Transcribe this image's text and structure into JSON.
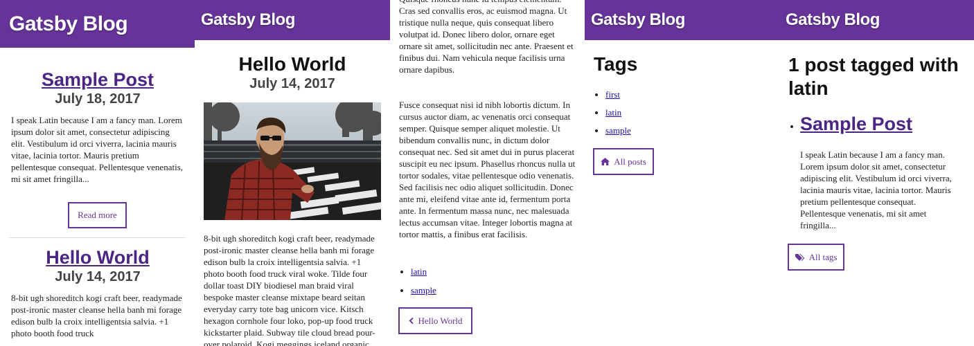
{
  "site_title": "Gatsby Blog",
  "brand_color": "#663399",
  "home": {
    "posts": [
      {
        "title": "Sample Post",
        "date": "July 18, 2017",
        "excerpt": "I speak Latin because I am a fancy man. Lorem ipsum dolor sit amet, consectetur adipiscing elit. Vestibulum id orci viverra, lacinia mauris vitae, lacinia tortor. Mauris pretium pellentesque consequat. Pellentesque venenatis, mi sit amet fringilla...",
        "read_more": "Read more"
      },
      {
        "title": "Hello World",
        "date": "July 14, 2017",
        "excerpt": "8-bit ugh shoreditch kogi craft beer, readymade post-ironic master cleanse hella banh mi forage edison bulb la croix intelligentsia salvia. +1 photo booth food truck"
      }
    ]
  },
  "post_page": {
    "title": "Hello World",
    "date": "July 14, 2017",
    "image_icon": "bearded-man-photo",
    "body": "8-bit ugh shoreditch kogi craft beer, readymade post-ironic master cleanse hella banh mi forage edison bulb la croix intelligentsia salvia. +1 photo booth food truck viral woke. Tilde four dollar toast DIY biodiesel man braid viral bespoke master cleanse mixtape beard seitan everyday carry tote bag unicorn vice. Kitsch hexagon cornhole four loko, pop-up food truck kickstarter plaid. Subway tile cloud bread pour-over polaroid. Kogi meggings iceland organic"
  },
  "post_continued": {
    "paragraph1": "Quisque rhoncus nunc id tempus elementum. Cras sed convallis eros, ac euismod magna. Ut tristique nulla neque, quis consequat libero volutpat id. Donec libero dolor, ornare eget ornare sit amet, sollicitudin nec ante. Praesent et finibus dui. Nam vehicula neque facilisis urna ornare dapibus.",
    "paragraph2": "Fusce consequat nisi id nibh lobortis dictum. In cursus auctor diam, ac venenatis orci consequat semper. Quisque semper aliquet molestie. Ut bibendum convallis nunc, in dictum dolor consequat nec. Sed sit amet dui in purus placerat suscipit eu nec ipsum. Phasellus rhoncus nulla ut tortor sodales, vitae pellentesque odio venenatis. Sed facilisis nec odio aliquet sollicitudin. Donec ante mi, eleifend vitae ante id, fermentum porta ante. In fermentum massa nunc, nec malesuada lectus accumsan vitae. Integer lobortis magna at tortor mattis, a finibus erat facilisis.",
    "tags": [
      "latin",
      "sample"
    ],
    "back_button": "Hello World",
    "back_icon": "chevron-left-icon"
  },
  "tags_page": {
    "title": "Tags",
    "tags": [
      "first",
      "latin",
      "sample"
    ],
    "all_posts_button": "All posts",
    "all_posts_icon": "home-icon"
  },
  "tag_page": {
    "title": "1 post tagged with latin",
    "post_title": "Sample Post",
    "excerpt": "I speak Latin because I am a fancy man. Lorem ipsum dolor sit amet, consectetur adipiscing elit. Vestibulum id orci viverra, lacinia mauris vitae, lacinia tortor. Mauris pretium pellentesque consequat. Pellentesque venenatis, mi sit amet fringilla...",
    "all_tags_button": "All tags",
    "all_tags_icon": "tags-icon"
  }
}
